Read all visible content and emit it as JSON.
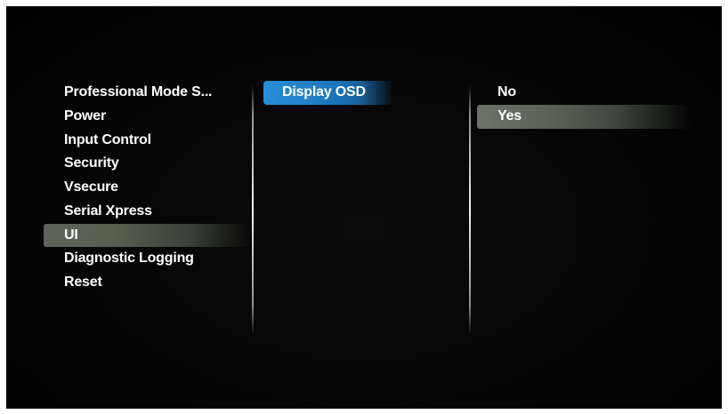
{
  "menu": {
    "left": [
      {
        "label": "Professional Mode S..."
      },
      {
        "label": "Power"
      },
      {
        "label": "Input Control"
      },
      {
        "label": "Security"
      },
      {
        "label": "Vsecure"
      },
      {
        "label": "Serial Xpress"
      },
      {
        "label": "UI",
        "selected": true
      },
      {
        "label": "Diagnostic Logging"
      },
      {
        "label": "Reset"
      }
    ],
    "middle": [
      {
        "label": "Display OSD",
        "focused": true
      }
    ],
    "right": [
      {
        "label": "No"
      },
      {
        "label": "Yes",
        "selected": true
      }
    ]
  },
  "colors": {
    "background": "#050505",
    "text": "#ffffff",
    "focus_highlight": "#1f7cc4",
    "selection_highlight": "#5b6658"
  }
}
